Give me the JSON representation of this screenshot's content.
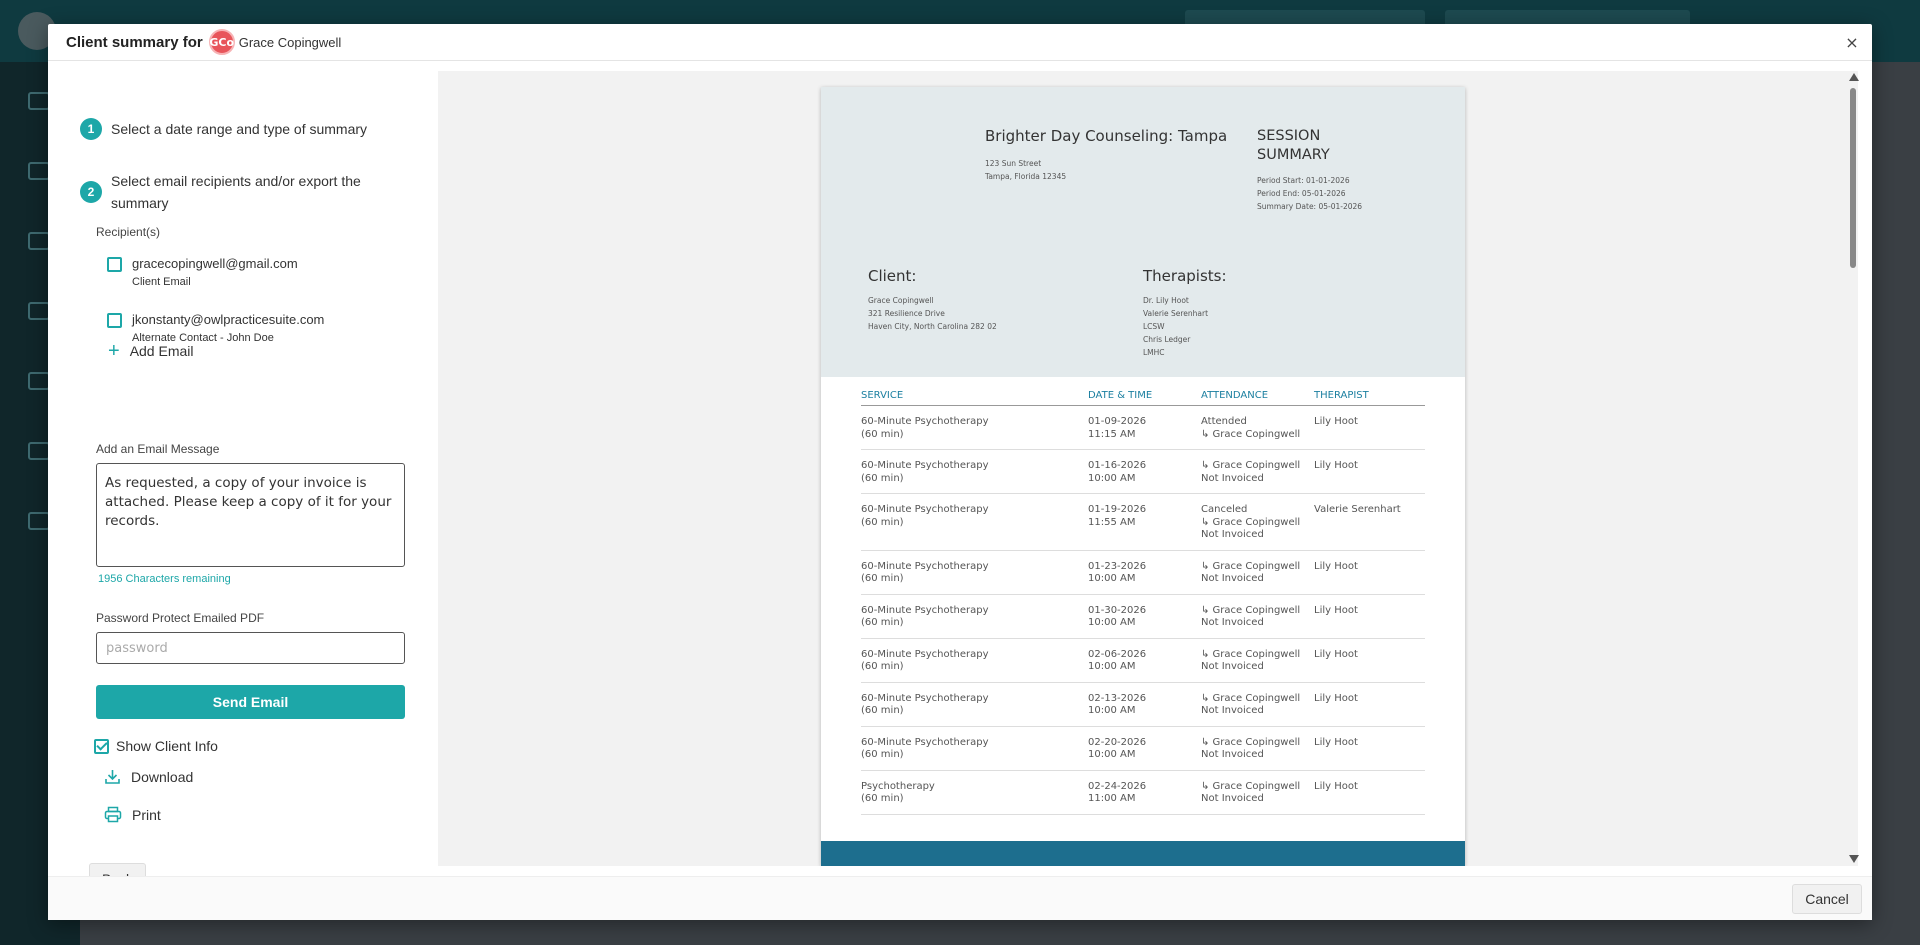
{
  "modal": {
    "title": "Client summary for",
    "client_initials": "GCo",
    "client_name": "Grace Copingwell",
    "close_label": "×",
    "cancel_label": "Cancel",
    "back_label": "Back"
  },
  "steps": [
    {
      "num": "1",
      "text": "Select a date range and type of summary"
    },
    {
      "num": "2",
      "text": "Select email recipients and/or export the summary"
    }
  ],
  "recipients": {
    "label": "Recipient(s)",
    "items": [
      {
        "email": "gracecopingwell@gmail.com",
        "sub": "Client Email",
        "checked": false
      },
      {
        "email": "jkonstanty@owlpracticesuite.com",
        "sub": "Alternate Contact - John Doe",
        "checked": false
      }
    ],
    "add_label": "Add Email"
  },
  "message": {
    "label": "Add an Email Message",
    "value": "As requested, a copy of your invoice is attached. Please keep a copy of it for your records.",
    "chars_remaining": "1956 Characters remaining"
  },
  "password": {
    "label": "Password Protect Emailed PDF",
    "placeholder": "password"
  },
  "actions": {
    "send_label": "Send Email",
    "show_client_info_label": "Show Client Info",
    "show_client_info_checked": true,
    "download_label": "Download",
    "print_label": "Print"
  },
  "document": {
    "org_name": "Brighter Day Counseling: Tampa",
    "org_address": [
      "123 Sun Street",
      "Tampa, Florida 12345"
    ],
    "summary_title": "SESSION SUMMARY",
    "summary_meta": [
      "Period Start: 01-01-2026",
      "Period End: 05-01-2026",
      "Summary Date: 05-01-2026"
    ],
    "client_heading": "Client:",
    "client_lines": [
      "Grace Copingwell",
      "321 Resilience Drive",
      "Haven City, North Carolina 282 02"
    ],
    "therapists_heading": "Therapists:",
    "therapist_lines": [
      "Dr. Lily Hoot",
      "Valerie Serenhart",
      "LCSW",
      "Chris Ledger",
      "LMHC"
    ],
    "columns": [
      "SERVICE",
      "DATE & TIME",
      "ATTENDANCE",
      "THERAPIST"
    ],
    "rows": [
      {
        "service": [
          "60-Minute Psychotherapy",
          "(60 min)"
        ],
        "datetime": [
          "01-09-2026",
          "11:15 AM"
        ],
        "attendance": [
          "Attended",
          "↳ Grace Copingwell"
        ],
        "therapist": "Lily Hoot"
      },
      {
        "service": [
          "60-Minute Psychotherapy",
          "(60 min)"
        ],
        "datetime": [
          "01-16-2026",
          "10:00 AM"
        ],
        "attendance": [
          "↳ Grace Copingwell",
          "Not Invoiced"
        ],
        "therapist": "Lily Hoot"
      },
      {
        "service": [
          "60-Minute Psychotherapy",
          "(60 min)"
        ],
        "datetime": [
          "01-19-2026",
          "11:55 AM"
        ],
        "attendance": [
          "Canceled",
          "↳ Grace Copingwell",
          "Not Invoiced"
        ],
        "therapist": "Valerie Serenhart"
      },
      {
        "service": [
          "60-Minute Psychotherapy",
          "(60 min)"
        ],
        "datetime": [
          "01-23-2026",
          "10:00 AM"
        ],
        "attendance": [
          "↳ Grace Copingwell",
          "Not Invoiced"
        ],
        "therapist": "Lily Hoot"
      },
      {
        "service": [
          "60-Minute Psychotherapy",
          "(60 min)"
        ],
        "datetime": [
          "01-30-2026",
          "10:00 AM"
        ],
        "attendance": [
          "↳ Grace Copingwell",
          "Not Invoiced"
        ],
        "therapist": "Lily Hoot"
      },
      {
        "service": [
          "60-Minute Psychotherapy",
          "(60 min)"
        ],
        "datetime": [
          "02-06-2026",
          "10:00 AM"
        ],
        "attendance": [
          "↳ Grace Copingwell",
          "Not Invoiced"
        ],
        "therapist": "Lily Hoot"
      },
      {
        "service": [
          "60-Minute Psychotherapy",
          "(60 min)"
        ],
        "datetime": [
          "02-13-2026",
          "10:00 AM"
        ],
        "attendance": [
          "↳ Grace Copingwell",
          "Not Invoiced"
        ],
        "therapist": "Lily Hoot"
      },
      {
        "service": [
          "60-Minute Psychotherapy",
          "(60 min)"
        ],
        "datetime": [
          "02-20-2026",
          "10:00 AM"
        ],
        "attendance": [
          "↳ Grace Copingwell",
          "Not Invoiced"
        ],
        "therapist": "Lily Hoot"
      },
      {
        "service": [
          "Psychotherapy",
          "(60 min)"
        ],
        "datetime": [
          "02-24-2026",
          "11:00 AM"
        ],
        "attendance": [
          "↳ Grace Copingwell",
          "Not Invoiced"
        ],
        "therapist": "Lily Hoot"
      }
    ]
  },
  "colors": {
    "accent": "#1da7a8",
    "doc_header_bg": "#e3eaec",
    "doc_table_header": "#1b7fa0",
    "doc_footer": "#1d6e8e",
    "avatar": "#e8555b"
  }
}
